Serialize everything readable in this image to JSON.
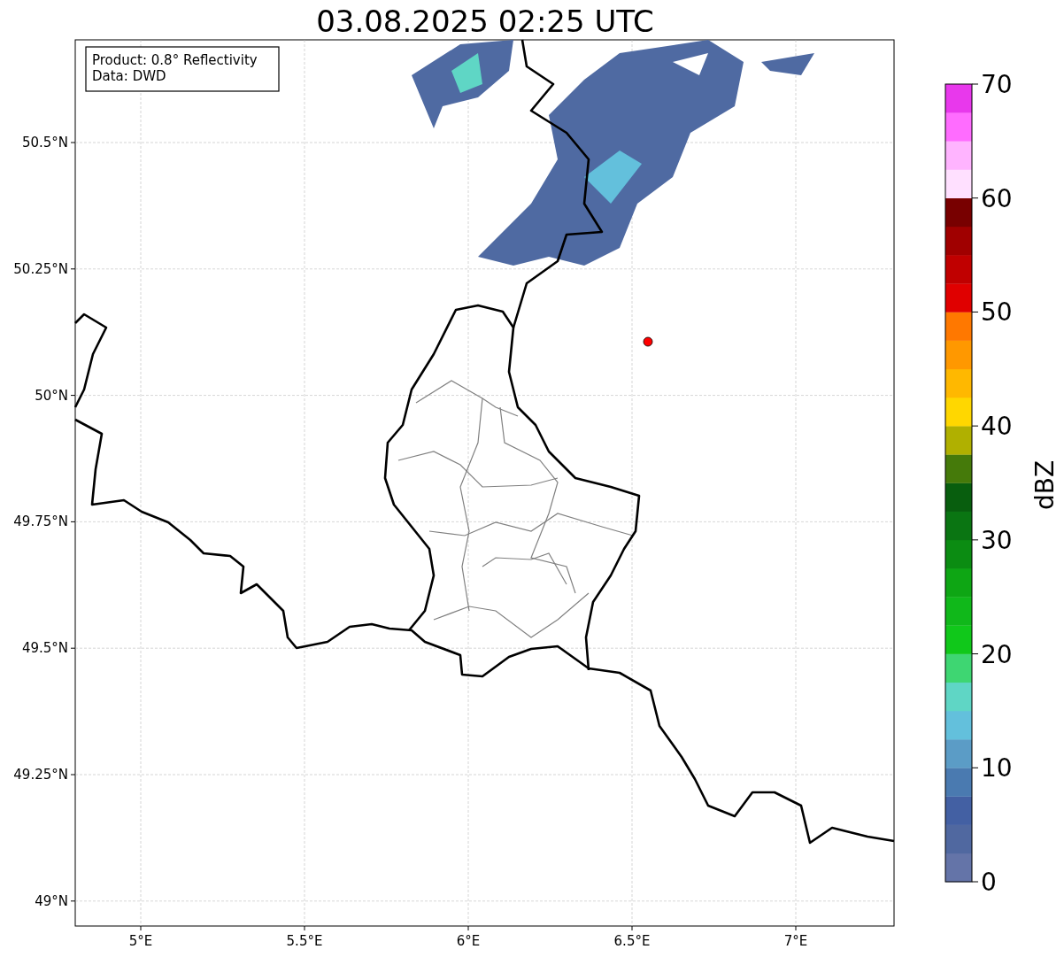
{
  "title": "03.08.2025 02:25 UTC",
  "info_box": [
    "Product: 0.8° Reflectivity",
    "Data: DWD"
  ],
  "y_ticks": [
    "50.5°N",
    "50.25°N",
    "50°N",
    "49.75°N",
    "49.5°N",
    "49.25°N",
    "49°N"
  ],
  "x_ticks": [
    "5°E",
    "5.5°E",
    "6°E",
    "6.5°E",
    "7°E"
  ],
  "colorbar": {
    "label": "dBZ",
    "ticks": [
      "70",
      "60",
      "50",
      "40",
      "30",
      "20",
      "10",
      "0"
    ],
    "bands": [
      {
        "color": "#6474a8"
      },
      {
        "color": "#5068a0"
      },
      {
        "color": "#4360a3"
      },
      {
        "color": "#4a7ab0"
      },
      {
        "color": "#5b9cc6"
      },
      {
        "color": "#63c0dc"
      },
      {
        "color": "#5fd6c5"
      },
      {
        "color": "#3ed672"
      },
      {
        "color": "#10c81a"
      },
      {
        "color": "#10b81a"
      },
      {
        "color": "#0ea614"
      },
      {
        "color": "#0b8c12"
      },
      {
        "color": "#0a7512"
      },
      {
        "color": "#085e0e"
      },
      {
        "color": "#457a0a"
      },
      {
        "color": "#b0b000"
      },
      {
        "color": "#ffd700"
      },
      {
        "color": "#ffb800"
      },
      {
        "color": "#ff9800"
      },
      {
        "color": "#ff7800"
      },
      {
        "color": "#e00000"
      },
      {
        "color": "#c00000"
      },
      {
        "color": "#a00000"
      },
      {
        "color": "#780000"
      },
      {
        "color": "#ffe0ff"
      },
      {
        "color": "#ffb4ff"
      },
      {
        "color": "#ff6cff"
      },
      {
        "color": "#e838ec"
      }
    ]
  }
}
